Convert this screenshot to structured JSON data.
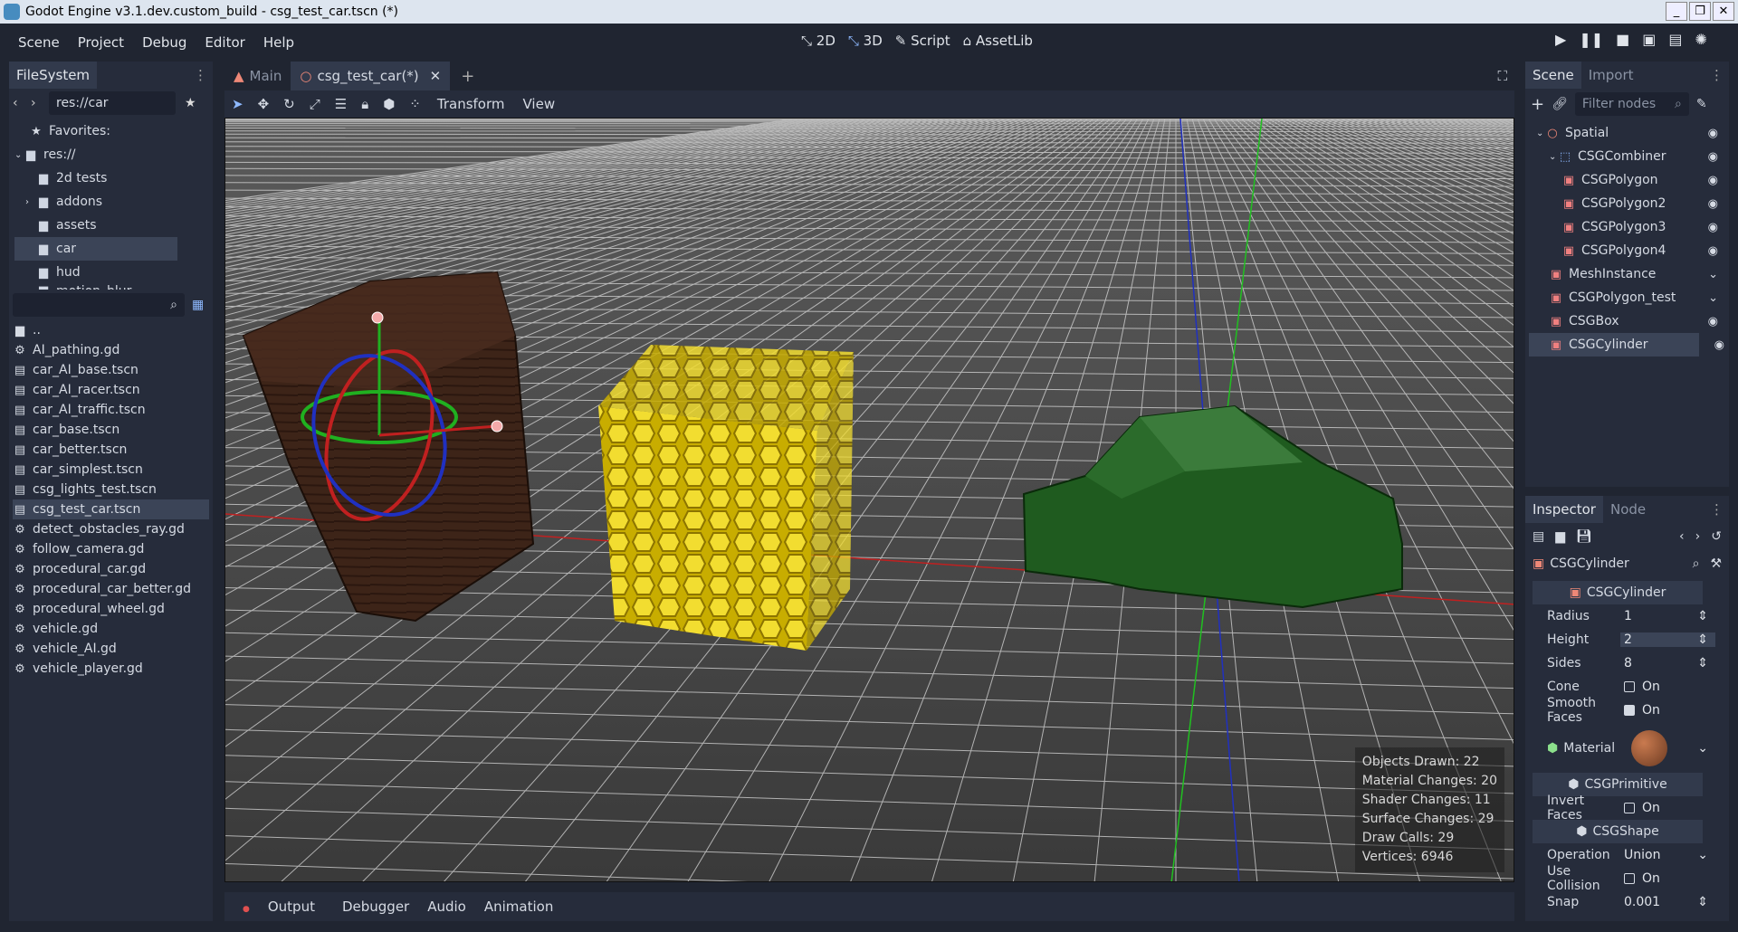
{
  "window": {
    "title": "Godot Engine v3.1.dev.custom_build - csg_test_car.tscn (*)",
    "buttons": [
      "_",
      "❐",
      "✕"
    ]
  },
  "menu": [
    "Scene",
    "Project",
    "Debug",
    "Editor",
    "Help"
  ],
  "modes": {
    "two_d": "2D",
    "three_d": "3D",
    "script": "Script",
    "assetlib": "AssetLib"
  },
  "filesystem": {
    "tab": "FileSystem",
    "path": "res://car",
    "favorites": "Favorites:",
    "root": "res://",
    "folders": [
      "2d tests",
      "addons",
      "assets",
      "car",
      "hud",
      "motion_blur"
    ],
    "files": [
      "..",
      "AI_pathing.gd",
      "car_AI_base.tscn",
      "car_AI_racer.tscn",
      "car_AI_traffic.tscn",
      "car_base.tscn",
      "car_better.tscn",
      "car_simplest.tscn",
      "csg_lights_test.tscn",
      "csg_test_car.tscn",
      "detect_obstacles_ray.gd",
      "follow_camera.gd",
      "procedural_car.gd",
      "procedural_car_better.gd",
      "procedural_wheel.gd",
      "vehicle.gd",
      "vehicle_AI.gd",
      "vehicle_player.gd"
    ]
  },
  "editor_tabs": {
    "main": "Main",
    "current": "csg_test_car(*)",
    "add": "+"
  },
  "viewport_toolbar": {
    "transform": "Transform",
    "view": "View"
  },
  "stats": [
    "Objects Drawn: 22",
    "Material Changes: 20",
    "Shader Changes: 11",
    "Surface Changes: 29",
    "Draw Calls: 29",
    "Vertices: 6946"
  ],
  "bottom": [
    "Output",
    "Debugger",
    "Audio",
    "Animation"
  ],
  "scene": {
    "tabs": [
      "Scene",
      "Import"
    ],
    "filter_placeholder": "Filter nodes",
    "nodes": [
      "Spatial",
      "CSGCombiner",
      "CSGPolygon",
      "CSGPolygon2",
      "CSGPolygon3",
      "CSGPolygon4",
      "MeshInstance",
      "CSGPolygon_test",
      "CSGBox",
      "CSGCylinder"
    ]
  },
  "inspector": {
    "tabs": [
      "Inspector",
      "Node"
    ],
    "object": "CSGCylinder",
    "sections": {
      "cyl": "CSGCylinder",
      "prim": "CSGPrimitive",
      "shape": "CSGShape"
    },
    "props": {
      "radius_k": "Radius",
      "radius_v": "1",
      "height_k": "Height",
      "height_v": "2",
      "sides_k": "Sides",
      "sides_v": "8",
      "cone_k": "Cone",
      "cone_v": "On",
      "smooth_k": "Smooth Faces",
      "smooth_v": "On",
      "material_k": "Material",
      "invert_k": "Invert Faces",
      "invert_v": "On",
      "operation_k": "Operation",
      "operation_v": "Union",
      "collision_k": "Use Collision",
      "collision_v": "On",
      "snap_k": "Snap",
      "snap_v": "0.001"
    }
  }
}
